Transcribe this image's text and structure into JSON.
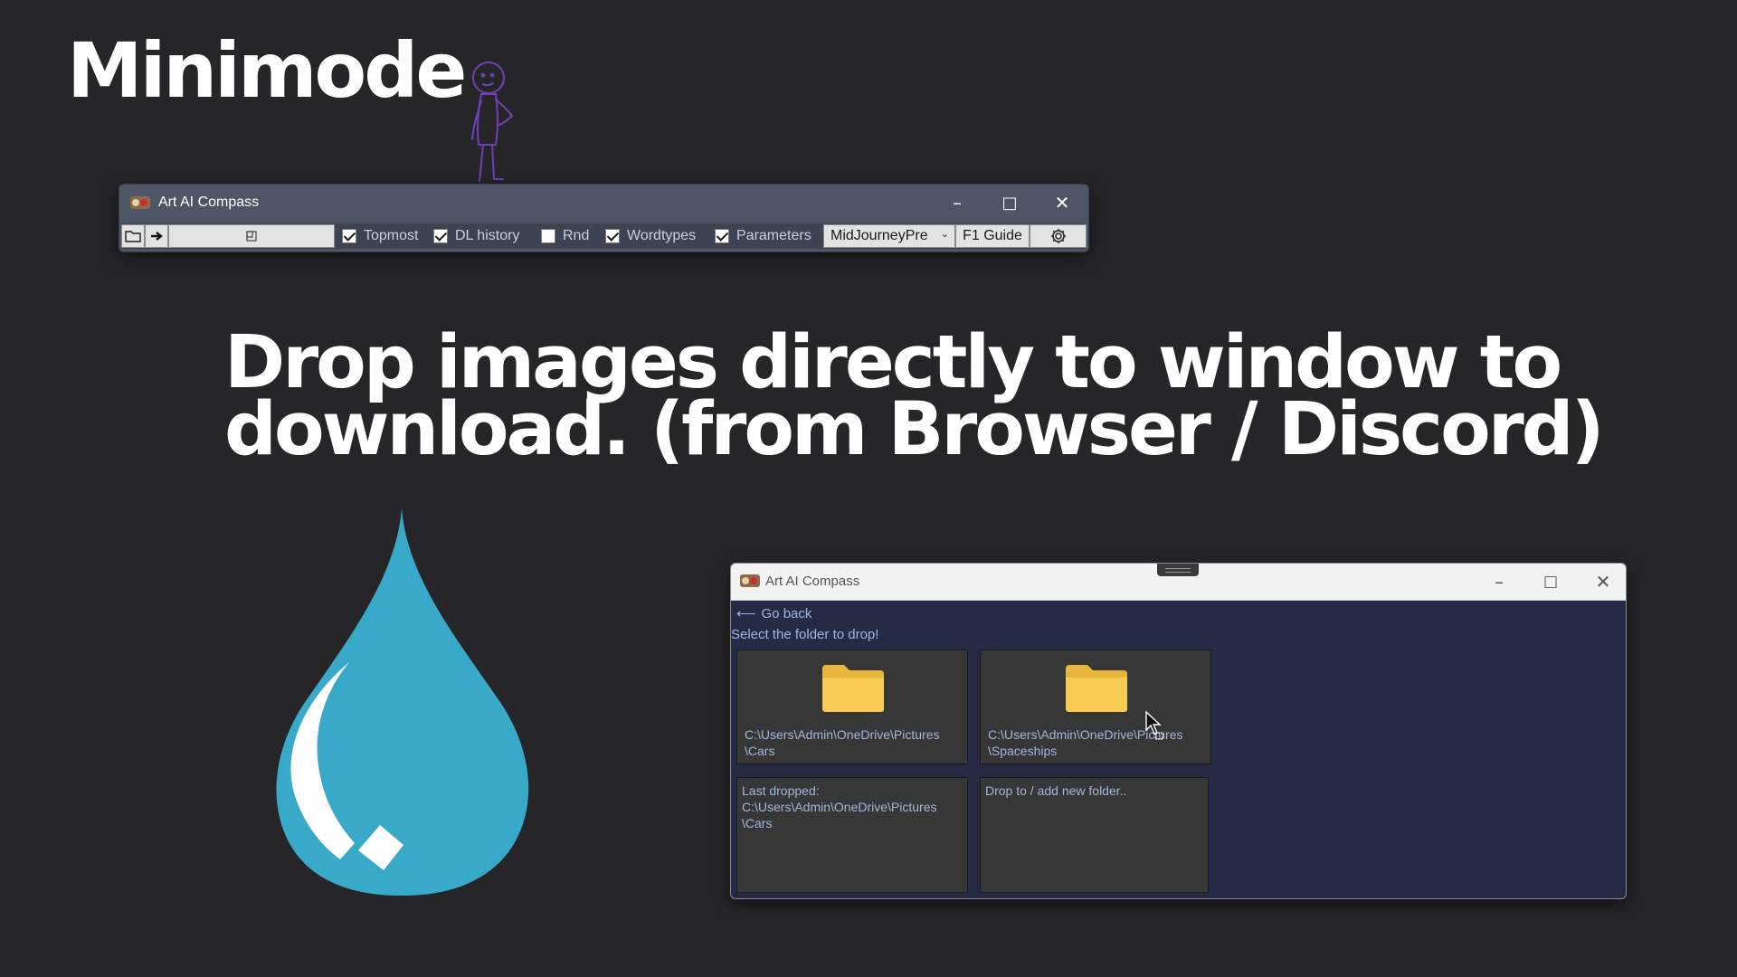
{
  "headings": {
    "minimode": "Minimode",
    "drop_line1": "Drop images directly to window to",
    "drop_line2": "download. (from Browser / Discord)"
  },
  "mini_window": {
    "title": "Art AI Compass",
    "controls": {
      "minimize": "–",
      "maximize": "□",
      "close": "✕"
    },
    "toolbar": {
      "checkboxes": [
        {
          "label": "Topmost",
          "checked": true
        },
        {
          "label": "DL history",
          "checked": true
        },
        {
          "label": "Rnd",
          "checked": false
        },
        {
          "label": "Wordtypes",
          "checked": true
        },
        {
          "label": "Parameters",
          "checked": true
        }
      ],
      "preset_select": "MidJourneyPre",
      "guide_button": "F1 Guide"
    }
  },
  "drop_window": {
    "title": "Art AI Compass",
    "controls": {
      "minimize": "–",
      "maximize": "□",
      "close": "✕"
    },
    "go_back": "Go back",
    "go_back_arrow": "⟵",
    "select_label": "Select the folder to drop!",
    "folders": [
      {
        "line1": "C:\\Users\\Admin\\OneDrive\\Pictures",
        "line2": "\\Cars"
      },
      {
        "line1": "C:\\Users\\Admin\\OneDrive\\Pictures",
        "line2": "\\Spaceships"
      }
    ],
    "last_dropped": {
      "label": "Last dropped:",
      "line1": "C:\\Users\\Admin\\OneDrive\\Pictures",
      "line2": "\\Cars"
    },
    "add_folder": "Drop to / add new folder.."
  },
  "colors": {
    "background": "#262629",
    "drop_blue": "#38a9c9",
    "folder_yellow": "#f6c94a",
    "window_body": "#262b45",
    "link_text": "#9fb6e0"
  },
  "icons": [
    "stick-figure",
    "folder-open-icon",
    "arrow-right-icon",
    "window-icon",
    "gear-icon",
    "water-drop-icon",
    "folder-icon",
    "mouse-cursor-icon"
  ]
}
